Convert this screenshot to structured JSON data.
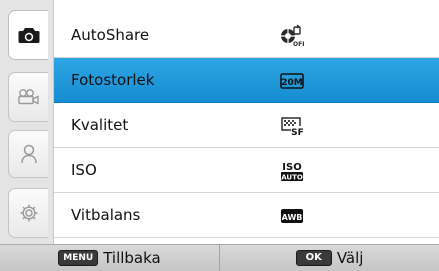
{
  "sidebar": {
    "tabs": [
      {
        "icon": "camera-icon",
        "active": true
      },
      {
        "icon": "video-camera-icon",
        "active": false
      },
      {
        "icon": "person-icon",
        "active": false
      },
      {
        "icon": "gear-icon",
        "active": false
      }
    ]
  },
  "menu": {
    "items": [
      {
        "label": "AutoShare",
        "icon": "autoshare-off-icon",
        "selected": false
      },
      {
        "label": "Fotostorlek",
        "icon": "photo-size-20m-icon",
        "icon_text": "20M",
        "selected": true
      },
      {
        "label": "Kvalitet",
        "icon": "quality-sf-icon",
        "icon_text": "SF",
        "selected": false
      },
      {
        "label": "ISO",
        "icon": "iso-auto-icon",
        "icon_text": "ISO",
        "icon_subtext": "AUTO",
        "selected": false
      },
      {
        "label": "Vitbalans",
        "icon": "white-balance-awb-icon",
        "icon_text": "AWB",
        "selected": false
      }
    ]
  },
  "footer": {
    "back_key": "MENU",
    "back_label": "Tillbaka",
    "select_key": "OK",
    "select_label": "Välj"
  },
  "colors": {
    "selected_row": "#1e98dc",
    "sidebar_bg": "#e4e4e4",
    "footer_bg": "#cfcfcf"
  }
}
